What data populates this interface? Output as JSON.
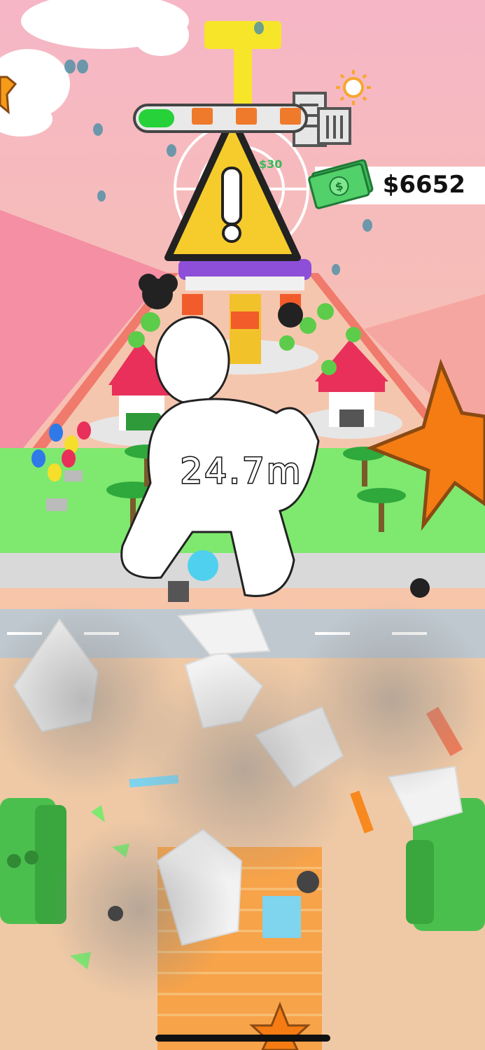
{
  "hud": {
    "money": "$6652",
    "distance": "24.7m",
    "level_progress": 0.22,
    "ferris_price": "$30"
  },
  "icons": {
    "city": "city-building-icon",
    "weather": "sun-icon",
    "cash": "cash-bill-icon",
    "warning": "warning-triangle-icon",
    "star": "star-icon"
  },
  "colors": {
    "sky_top": "#f6b6c6",
    "sky_bottom": "#f7d59a",
    "ground": "#efc9a6",
    "grass": "#7fe86f",
    "warning_yellow": "#f6cc2c",
    "star_orange": "#f57c12",
    "money_green": "#3db85a",
    "progress_green": "#27d13a"
  }
}
